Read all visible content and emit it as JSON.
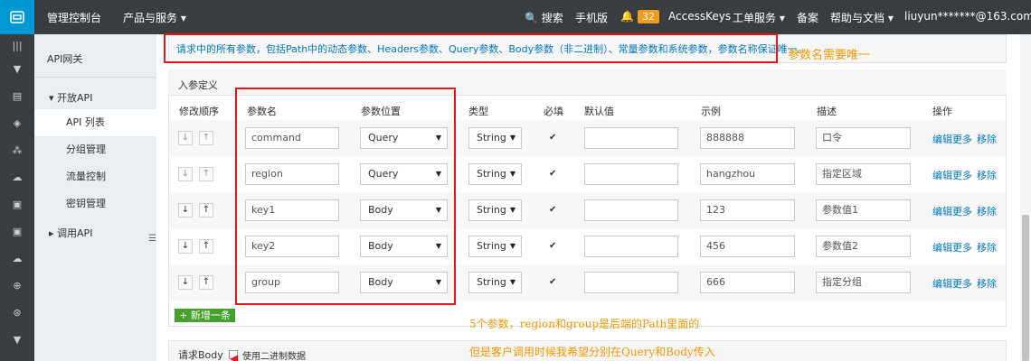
{
  "topbar": {
    "brand": "管理控制台",
    "products": "产品与服务 ▾",
    "search": "🔍 搜索",
    "mobile": "手机版",
    "notif_count": "32",
    "accesskeys": "AccessKeys",
    "ticket": "工单服务 ▾",
    "icp": "备案",
    "help": "帮助与文档 ▾",
    "user": "liuyun*******@163.com ▾"
  },
  "sidebar": {
    "title": "API网关",
    "group_open": "开放API",
    "items": [
      "API 列表",
      "分组管理",
      "流量控制",
      "密钥管理"
    ],
    "group_call": "调用API"
  },
  "notice": "请求中的所有参数，包括Path中的动态参数、Headers参数、Query参数、Body参数（非二进制）、常量参数和系统参数，参数名称保证唯一。",
  "annotation_unique": "参数名需要唯一",
  "panel_title": "入参定义",
  "columns": [
    "修改顺序",
    "参数名",
    "参数位置",
    "类型",
    "必填",
    "默认值",
    "示例",
    "描述",
    "操作"
  ],
  "rows": [
    {
      "name": "command",
      "location": "Query",
      "type": "String",
      "required": true,
      "default": "",
      "example": "888888",
      "desc": "口令"
    },
    {
      "name": "region",
      "location": "Query",
      "type": "String",
      "required": true,
      "default": "",
      "example": "hangzhou",
      "desc": "指定区域"
    },
    {
      "name": "key1",
      "location": "Body",
      "type": "String",
      "required": true,
      "default": "",
      "example": "123",
      "desc": "参数值1"
    },
    {
      "name": "key2",
      "location": "Body",
      "type": "String",
      "required": true,
      "default": "",
      "example": "456",
      "desc": "参数值2"
    },
    {
      "name": "group",
      "location": "Body",
      "type": "String",
      "required": true,
      "default": "",
      "example": "666",
      "desc": "指定分组"
    }
  ],
  "actions": {
    "edit": "编辑更多",
    "remove": "移除"
  },
  "add_button": "+ 新增一条",
  "annotation_path": "5个参数，region和group是后端的Path里面的",
  "annotation_split": "但是客户调用时候我希望分别在Query和Body传入",
  "body_label": "请求Body",
  "binary_label": "使用二进制数据",
  "colors": {
    "topbar": "#373d41",
    "logo": "#0099d6",
    "link": "#0077c0",
    "annotation": "#f39800",
    "highlight": "#e0151e",
    "add": "#45a02d"
  }
}
